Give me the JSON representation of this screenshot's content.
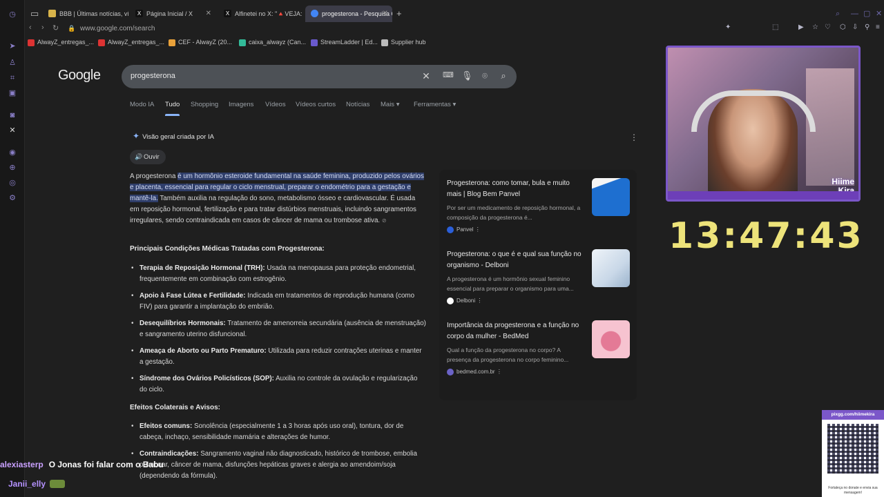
{
  "browser": {
    "tabs": [
      {
        "label": "BBB | Últimas notícias, víd",
        "fav": "#d8b34a"
      },
      {
        "label": "Página Inicial / X",
        "fav": "#000000"
      },
      {
        "label": "Alfinetei no X: \"🔺VEJA: Ju",
        "fav": "#000000"
      },
      {
        "label": "progesterona - Pesquisa G",
        "fav": "#4285f4"
      }
    ],
    "url": "www.google.com/search",
    "bookmarks": [
      {
        "label": "AlwayZ_entregas_...",
        "color": "#d33"
      },
      {
        "label": "AlwayZ_entregas_...",
        "color": "#d33"
      },
      {
        "label": "CEF - AlwayZ (20...",
        "color": "#e8a13a"
      },
      {
        "label": "caixa_alwayz (Can...",
        "color": "#3b9"
      },
      {
        "label": "StreamLadder | Ed...",
        "color": "#6a5acd"
      },
      {
        "label": "Supplier hub",
        "color": "#bbb"
      }
    ]
  },
  "google": {
    "logo": "Google",
    "query": "progesterona",
    "tabs": [
      "Modo IA",
      "Tudo",
      "Shopping",
      "Imagens",
      "Vídeos",
      "Vídeos curtos",
      "Notícias",
      "Mais",
      "Ferramentas"
    ],
    "ai_header": "Visão geral criada por IA",
    "listen": "Ouvir",
    "intro_pre": "A progesterona ",
    "intro_hl": "é um hormônio esteroide fundamental na saúde feminina, produzido pelos ovários e placenta, essencial para regular o ciclo menstrual, preparar o endométrio para a gestação e mantê-la.",
    "intro_post": " Também auxilia na regulação do sono, metabolismo ósseo e cardiovascular. É usada em reposição hormonal, fertilização e para tratar distúrbios menstruais, incluindo sangramentos irregulares, sendo contraindicada em casos de câncer de mama ou trombose ativa.",
    "sec1": "Principais Condições Médicas Tratadas com Progesterona:",
    "items1": [
      {
        "b": "Terapia de Reposição Hormonal (TRH):",
        "t": " Usada na menopausa para proteção endometrial, frequentemente em combinação com estrogênio."
      },
      {
        "b": "Apoio à Fase Lútea e Fertilidade:",
        "t": " Indicada em tratamentos de reprodução humana (como FIV) para garantir a implantação do embrião."
      },
      {
        "b": "Desequilíbrios Hormonais:",
        "t": " Tratamento de amenorreia secundária (ausência de menstruação) e sangramento uterino disfuncional."
      },
      {
        "b": "Ameaça de Aborto ou Parto Prematuro:",
        "t": " Utilizada para reduzir contrações uterinas e manter a gestação."
      },
      {
        "b": "Síndrome dos Ovários Policísticos (SOP):",
        "t": " Auxilia no controle da ovulação e regularização do ciclo."
      }
    ],
    "sec2": "Efeitos Colaterais e Avisos:",
    "items2": [
      {
        "b": "Efeitos comuns:",
        "t": " Sonolência (especialmente 1 a 3 horas após uso oral), tontura, dor de cabeça, inchaço, sensibilidade mamária e alterações de humor."
      },
      {
        "b": "Contraindicações:",
        "t": " Sangramento vaginal não diagnosticado, histórico de trombose, embolia pulmonar, câncer de mama, disfunções hepáticas graves e alergia ao amendoim/soja (dependendo da fórmula)."
      }
    ],
    "cards": [
      {
        "title": "Progesterona: como tomar, bula e muito mais | Blog Bem Panvel",
        "desc": "Por ser um medicamento de reposição hormonal, a composição da progesterona é...",
        "source": "Panvel",
        "srccolor": "#2b5fd9",
        "thumb": "#1e6fd0"
      },
      {
        "title": "Progesterona: o que é e qual sua função no organismo - Delboni",
        "desc": "A progesterona é um hormônio sexual feminino essencial para preparar o organismo para uma...",
        "source": "Delboni",
        "srccolor": "#ffffff",
        "thumb": "#d9e4ef"
      },
      {
        "title": "Importância da progesterona e a função no corpo da mulher - BedMed",
        "desc": "Qual a função da progesterona no corpo? A presença da progesterona no corpo feminino...",
        "source": "bedmed.com.br",
        "srccolor": "#6b63c7",
        "thumb": "#f2b8c8"
      }
    ]
  },
  "stream": {
    "tag_line1": "Hiime",
    "tag_line2": "Kira",
    "clock": "13:47:43",
    "qr_header": "pixgg.com/hiimekira",
    "qr_footer": "Fortaleça no donate e envia sua mensagem!"
  },
  "chat": {
    "user1": "alexiasterp",
    "msg1": "O Jonas foi falar com o Babu",
    "user2": "Janii_elly"
  }
}
